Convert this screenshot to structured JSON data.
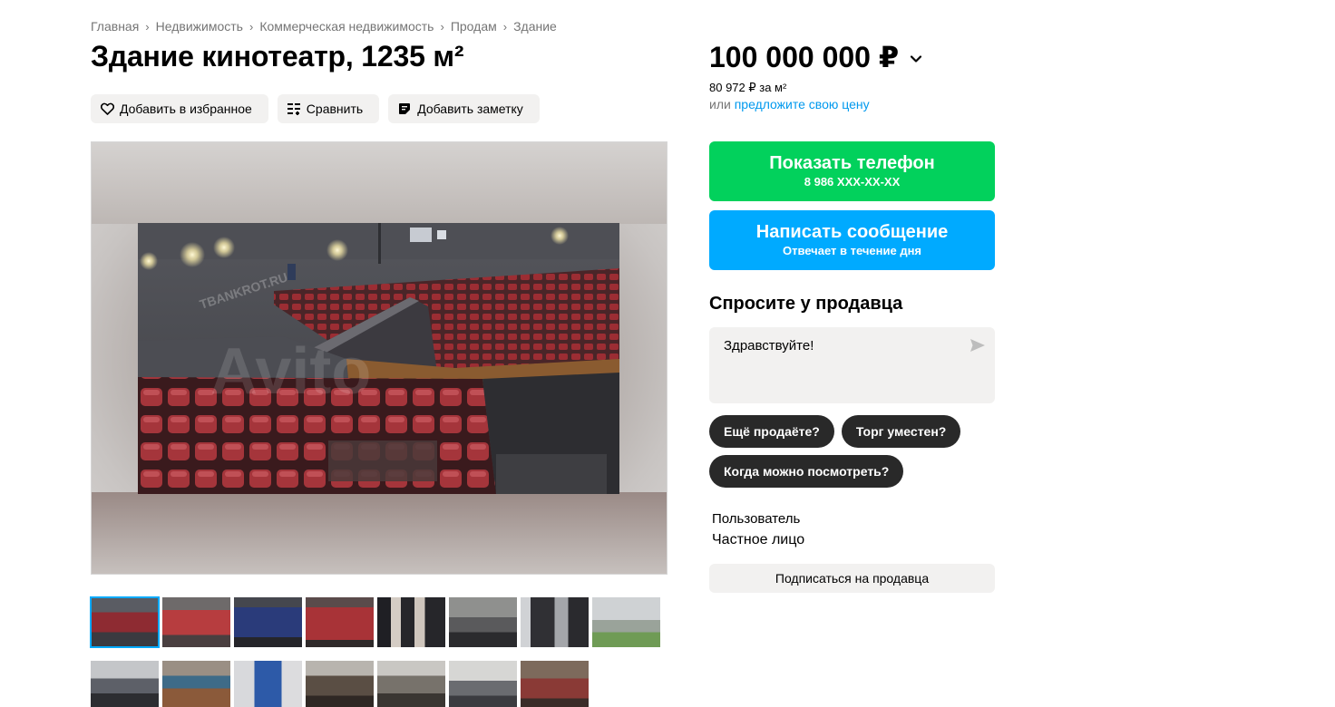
{
  "breadcrumb": {
    "items": [
      "Главная",
      "Недвижимость",
      "Коммерческая недвижимость",
      "Продам",
      "Здание"
    ],
    "separator": "›"
  },
  "listing": {
    "title": "Здание кинотеатр, 1235 м²"
  },
  "actions": {
    "favorite_label": "Добавить в избранное",
    "compare_label": "Сравнить",
    "note_label": "Добавить заметку"
  },
  "gallery": {
    "watermark_text": "Avito",
    "overlay_text": "TBANKROT.RU",
    "thumbnail_count": 15,
    "active_thumbnail": 1
  },
  "price": {
    "value": "100 000 000 ₽",
    "per_m2": "80 972 ₽ за м²",
    "offer_prefix": "или ",
    "offer_link": "предложите свою цену"
  },
  "contact": {
    "phone_label": "Показать телефон",
    "phone_number": "8 986 XXX-XX-XX",
    "message_label": "Написать сообщение",
    "message_sub": "Отвечает в течение дня"
  },
  "ask": {
    "title": "Спросите у продавца",
    "input_value": "Здравствуйте!",
    "chips": [
      "Ещё продаёте?",
      "Торг уместен?",
      "Когда можно посмотреть?"
    ]
  },
  "seller": {
    "type": "Пользователь",
    "name": "Частное лицо",
    "subscribe_label": "Подписаться на продавца"
  },
  "colors": {
    "green": "#02d15c",
    "blue": "#00aaff",
    "link": "#0099ee",
    "chip": "#292929",
    "muted_bg": "#f2f1f0"
  }
}
